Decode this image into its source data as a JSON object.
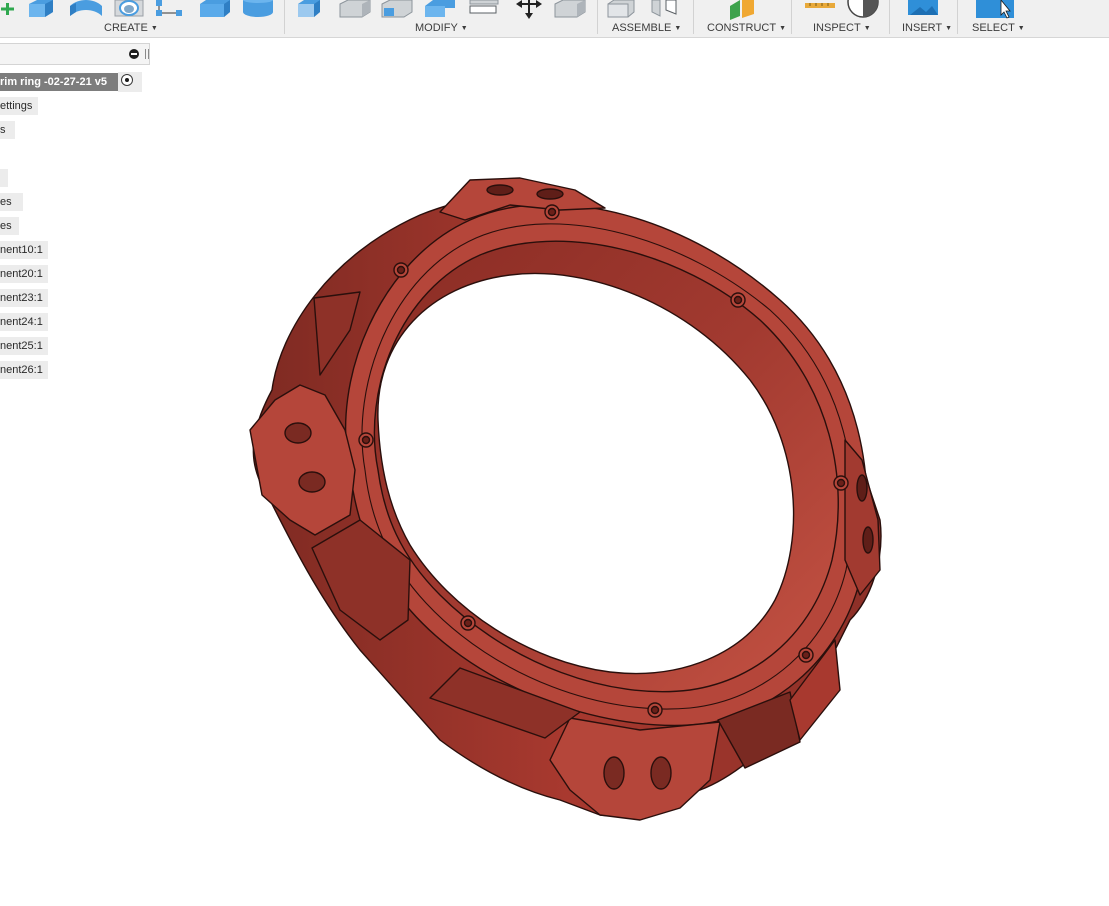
{
  "toolbar": {
    "groups": [
      {
        "label": "CREATE"
      },
      {
        "label": "MODIFY"
      },
      {
        "label": "ASSEMBLE"
      },
      {
        "label": "CONSTRUCT"
      },
      {
        "label": "INSPECT"
      },
      {
        "label": "INSERT"
      },
      {
        "label": "SELECT"
      }
    ],
    "icons": [
      "add-sketch-icon",
      "extrude-icon",
      "revolve-icon",
      "hole-icon",
      "pattern-icon",
      "box-icon",
      "cylinder-icon",
      "press-pull-icon",
      "fillet-icon",
      "chamfer-icon",
      "shell-icon",
      "draft-icon",
      "move-icon",
      "align-icon",
      "new-component-icon",
      "joint-icon",
      "offset-plane-icon",
      "measure-icon",
      "zebra-analysis-icon",
      "insert-image-icon",
      "select-cursor-icon"
    ],
    "accent_color": "#3d8fd6"
  },
  "browser": {
    "rows": [
      {
        "label": "rim ring -02-27-21 v5",
        "is_root": true
      },
      {
        "label": "ettings"
      },
      {
        "label": "s"
      },
      {
        "label": ""
      },
      {
        "label": "es"
      },
      {
        "label": "es"
      },
      {
        "label": "nent10:1"
      },
      {
        "label": "nent20:1"
      },
      {
        "label": "nent23:1"
      },
      {
        "label": "nent24:1"
      },
      {
        "label": "nent25:1"
      },
      {
        "label": "nent26:1"
      }
    ],
    "icons": [
      "collapse-panel-icon",
      "pin-panel-icon",
      "activate-component-icon"
    ]
  },
  "viewport": {
    "model": "rim-ring",
    "model_color": "#b5463a",
    "background_color": "#ffffff"
  }
}
